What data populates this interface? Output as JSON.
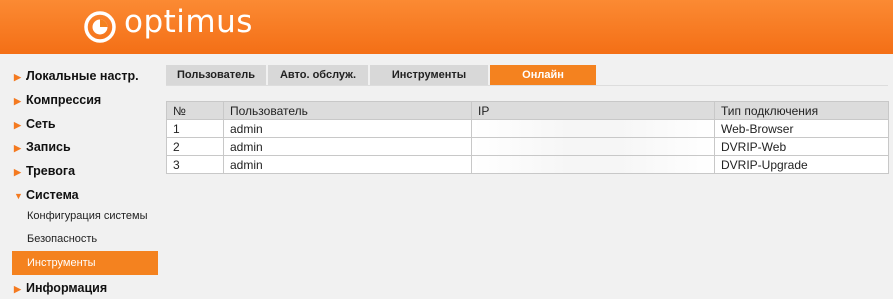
{
  "header": {
    "logo_text": "optimus",
    "brand_color": "#f4821f"
  },
  "sidebar": {
    "items": [
      {
        "label": "Локальные настр."
      },
      {
        "label": "Компрессия"
      },
      {
        "label": "Сеть"
      },
      {
        "label": "Запись"
      },
      {
        "label": "Тревога"
      },
      {
        "label": "Система"
      }
    ],
    "system_subitems": [
      {
        "label": "Конфигурация системы"
      },
      {
        "label": "Безопасность"
      },
      {
        "label": "Инструменты",
        "active": true
      }
    ],
    "info": {
      "label": "Информация"
    }
  },
  "tabs": [
    {
      "label": "Пользователь"
    },
    {
      "label": "Авто. обслуж."
    },
    {
      "label": "Инструменты"
    },
    {
      "label": "Онлайн",
      "active": true
    }
  ],
  "table": {
    "headers": [
      "№",
      "Пользователь",
      "IP",
      "Тип подключения"
    ],
    "rows": [
      {
        "num": "1",
        "user": "admin",
        "ip": "",
        "type": "Web-Browser"
      },
      {
        "num": "2",
        "user": "admin",
        "ip": "",
        "type": "DVRIP-Web"
      },
      {
        "num": "3",
        "user": "admin",
        "ip": "",
        "type": "DVRIP-Upgrade"
      }
    ]
  }
}
